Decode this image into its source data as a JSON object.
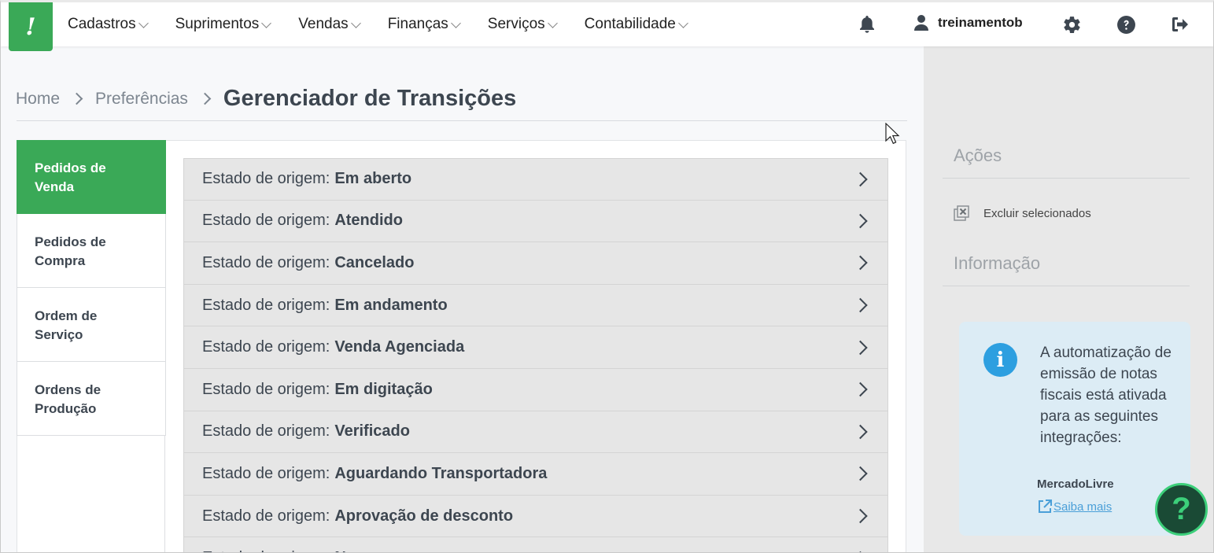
{
  "nav": {
    "logo": "!",
    "items": [
      {
        "label": "Cadastros"
      },
      {
        "label": "Suprimentos"
      },
      {
        "label": "Vendas"
      },
      {
        "label": "Finanças"
      },
      {
        "label": "Serviços"
      },
      {
        "label": "Contabilidade"
      }
    ],
    "username": "treinamentob"
  },
  "breadcrumb": {
    "home": "Home",
    "parent": "Preferências",
    "current": "Gerenciador de Transições"
  },
  "tabs": [
    {
      "label": "Pedidos de Venda",
      "active": true
    },
    {
      "label": "Pedidos de Compra",
      "active": false
    },
    {
      "label": "Ordem de Serviço",
      "active": false
    },
    {
      "label": "Ordens de Produção",
      "active": false
    }
  ],
  "list": {
    "prefix": "Estado de origem:",
    "rows": [
      {
        "state": "Em aberto"
      },
      {
        "state": "Atendido"
      },
      {
        "state": "Cancelado"
      },
      {
        "state": "Em andamento"
      },
      {
        "state": "Venda Agenciada"
      },
      {
        "state": "Em digitação"
      },
      {
        "state": "Verificado"
      },
      {
        "state": "Aguardando Transportadora"
      },
      {
        "state": "Aprovação de desconto"
      },
      {
        "state": "N..."
      }
    ]
  },
  "side": {
    "actions_title": "Ações",
    "delete_selected": "Excluir selecionados",
    "info_title": "Informação",
    "info_text": "A automatização de emissão de notas fiscais está ativada para as seguintes integrações:",
    "integration": "MercadoLivre",
    "learn_more": "Saiba mais"
  },
  "colors": {
    "brand_green": "#3aa957",
    "info_blue": "#2d9fe0",
    "fab_bg": "#1a4a35"
  }
}
